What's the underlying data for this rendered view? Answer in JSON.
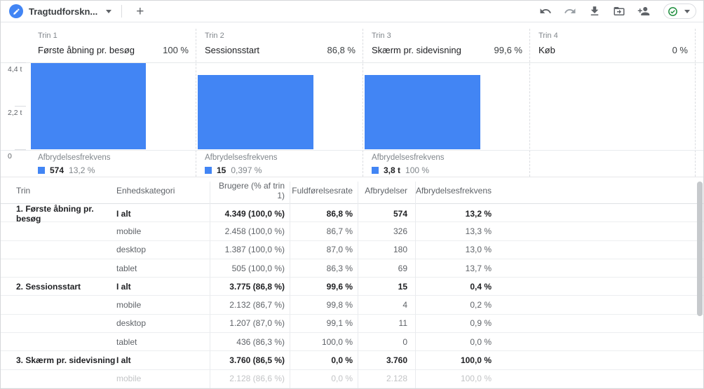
{
  "topbar": {
    "tab_title": "Tragtudforskn...",
    "add_tab_label": "+",
    "icons": {
      "tab": "edit-pencil",
      "undo": "undo-arrow",
      "redo": "redo-arrow",
      "download": "download-arrow",
      "export": "folder-export",
      "add_user": "person-add",
      "status": "check-circle"
    },
    "status_color": "#1e8e3e"
  },
  "funnel": {
    "y_axis_labels": [
      "4,4 t",
      "2,2 t",
      "0"
    ],
    "y_max": 4400,
    "bar_values": [
      4349,
      3775,
      3760,
      0
    ],
    "bar_color": "#4285f4",
    "steps": [
      {
        "step_label": "Trin 1",
        "name": "Første åbning pr. besøg",
        "pct": "100 %",
        "dropoff_label": "Afbrydelsesfrekvens",
        "dropoff_value": "574",
        "dropoff_pct": "13,2 %"
      },
      {
        "step_label": "Trin 2",
        "name": "Sessionsstart",
        "pct": "86,8 %",
        "dropoff_label": "Afbrydelsesfrekvens",
        "dropoff_value": "15",
        "dropoff_pct": "0,397 %"
      },
      {
        "step_label": "Trin 3",
        "name": "Skærm pr. sidevisning",
        "pct": "99,6 %",
        "dropoff_label": "Afbrydelsesfrekvens",
        "dropoff_value": "3,8 t",
        "dropoff_pct": "100 %"
      },
      {
        "step_label": "Trin 4",
        "name": "Køb",
        "pct": "0 %"
      }
    ]
  },
  "table": {
    "columns": [
      "Trin",
      "Enhedskategori",
      "Brugere (% af trin 1)",
      "Fuldførelsesrate",
      "Afbrydelser",
      "Afbrydelsesfrekvens"
    ],
    "rows": [
      {
        "trin": "1. Første åbning pr. besøg",
        "device": "I alt",
        "users": "4.349 (100,0 %)",
        "completion": "86,8 %",
        "abandonments": "574",
        "abandonment_rate": "13,2 %"
      },
      {
        "trin": "",
        "device": "mobile",
        "users": "2.458 (100,0 %)",
        "completion": "86,7 %",
        "abandonments": "326",
        "abandonment_rate": "13,3 %"
      },
      {
        "trin": "",
        "device": "desktop",
        "users": "1.387 (100,0 %)",
        "completion": "87,0 %",
        "abandonments": "180",
        "abandonment_rate": "13,0 %"
      },
      {
        "trin": "",
        "device": "tablet",
        "users": "505 (100,0 %)",
        "completion": "86,3 %",
        "abandonments": "69",
        "abandonment_rate": "13,7 %"
      },
      {
        "trin": "2. Sessionsstart",
        "device": "I alt",
        "users": "3.775 (86,8 %)",
        "completion": "99,6 %",
        "abandonments": "15",
        "abandonment_rate": "0,4 %"
      },
      {
        "trin": "",
        "device": "mobile",
        "users": "2.132 (86,7 %)",
        "completion": "99,8 %",
        "abandonments": "4",
        "abandonment_rate": "0,2 %"
      },
      {
        "trin": "",
        "device": "desktop",
        "users": "1.207 (87,0 %)",
        "completion": "99,1 %",
        "abandonments": "11",
        "abandonment_rate": "0,9 %"
      },
      {
        "trin": "",
        "device": "tablet",
        "users": "436 (86,3 %)",
        "completion": "100,0 %",
        "abandonments": "0",
        "abandonment_rate": "0,0 %"
      },
      {
        "trin": "3. Skærm pr. sidevisning",
        "device": "I alt",
        "users": "3.760 (86,5 %)",
        "completion": "0,0 %",
        "abandonments": "3.760",
        "abandonment_rate": "100,0 %"
      },
      {
        "trin": "",
        "device": "mobile",
        "users": "2.128 (86,6 %)",
        "completion": "0,0 %",
        "abandonments": "2.128",
        "abandonment_rate": "100,0 %"
      }
    ]
  }
}
